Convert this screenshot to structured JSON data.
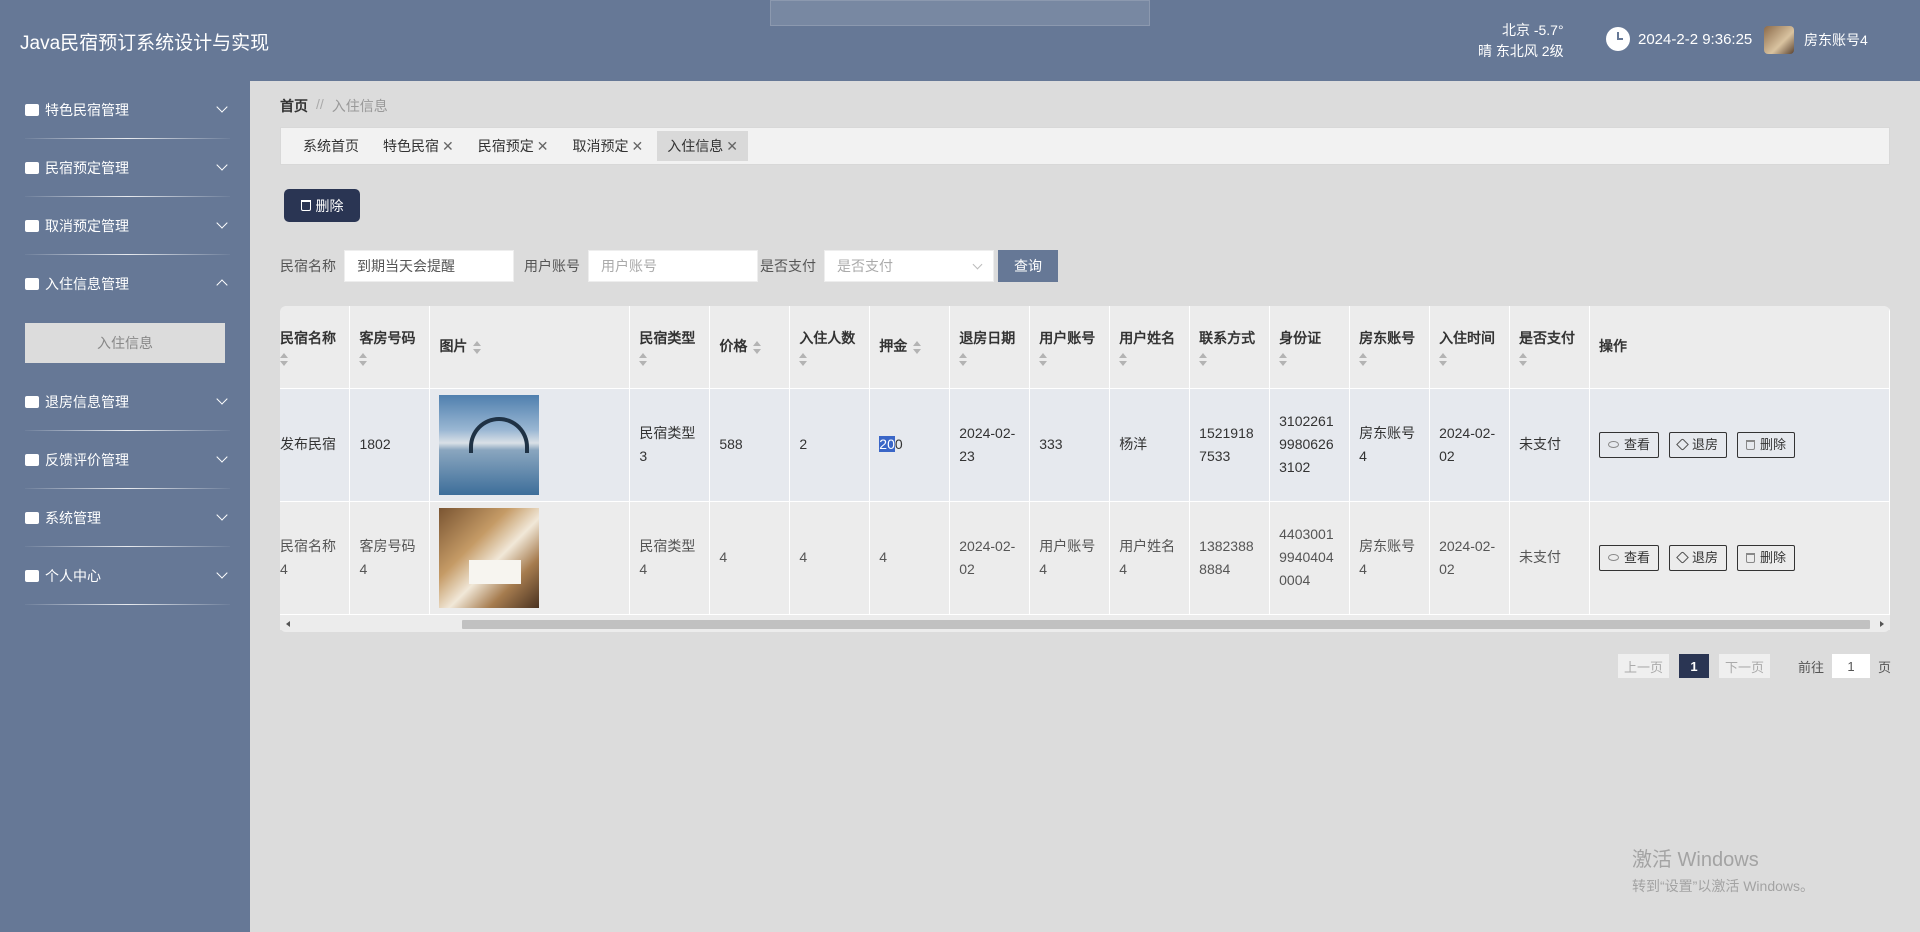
{
  "header": {
    "title": "Java民宿预订系统设计与实现",
    "weather_line1": "北京  -5.7°",
    "weather_line2": "晴  东北风  2级",
    "datetime": "2024-2-2 9:36:25",
    "user_name": "房东账号4"
  },
  "sidebar": {
    "items": [
      {
        "label": "特色民宿管理",
        "icon": "house-icon"
      },
      {
        "label": "民宿预定管理",
        "icon": "sliders-icon"
      },
      {
        "label": "取消预定管理",
        "icon": "briefcase-icon"
      },
      {
        "label": "入住信息管理",
        "icon": "chat-icon"
      },
      {
        "label": "退房信息管理",
        "icon": "clipboard-icon"
      },
      {
        "label": "反馈评价管理",
        "icon": "grid-icon"
      },
      {
        "label": "系统管理",
        "icon": "flag-icon"
      },
      {
        "label": "个人中心",
        "icon": "card-icon"
      }
    ],
    "active_sub": "入住信息"
  },
  "breadcrumb": {
    "home": "首页",
    "sep": "//",
    "current": "入住信息"
  },
  "tabs": [
    {
      "label": "系统首页",
      "closable": false
    },
    {
      "label": "特色民宿",
      "closable": true
    },
    {
      "label": "民宿预定",
      "closable": true
    },
    {
      "label": "取消预定",
      "closable": true
    },
    {
      "label": "入住信息",
      "closable": true
    }
  ],
  "toolbar": {
    "delete_label": "删除"
  },
  "search": {
    "name_label": "民宿名称",
    "name_value": "到期当天会提醒",
    "user_label": "用户账号",
    "user_placeholder": "用户账号",
    "paid_label": "是否支付",
    "paid_placeholder": "是否支付",
    "query_label": "查询"
  },
  "table": {
    "headers": [
      "民宿名称",
      "客房号码",
      "图片",
      "民宿类型",
      "价格",
      "入住人数",
      "押金",
      "退房日期",
      "用户账号",
      "用户姓名",
      "联系方式",
      "身份证",
      "房东账号",
      "入住时间",
      "是否支付",
      "操作"
    ],
    "rows": [
      {
        "name": "发布民宿",
        "room": "1802",
        "type": "民宿类型3",
        "price": "588",
        "people": "2",
        "deposit_a": "20",
        "deposit_b": "0",
        "checkout": "2024-02-23",
        "user": "333",
        "username": "杨洋",
        "phone": "15219187533",
        "idcard": "310226199806263102",
        "landlord": "房东账号4",
        "checkin": "2024-02-02",
        "paid": "未支付"
      },
      {
        "name": "民宿名称4",
        "room": "客房号码4",
        "type": "民宿类型4",
        "price": "4",
        "people": "4",
        "deposit_a": "4",
        "deposit_b": "",
        "checkout": "2024-02-02",
        "user": "用户账号4",
        "username": "用户姓名4",
        "phone": "13823888884",
        "idcard": "440300199404040004",
        "landlord": "房东账号4",
        "checkin": "2024-02-02",
        "paid": "未支付"
      }
    ],
    "ops": {
      "view": "查看",
      "checkout": "退房",
      "delete": "删除"
    }
  },
  "pager": {
    "prev": "上一页",
    "current": "1",
    "next": "下一页",
    "goto_label": "前往",
    "goto_value": "1",
    "page_unit": "页"
  },
  "watermark": {
    "line1": "激活 Windows",
    "line2": "转到“设置”以激活 Windows。"
  }
}
